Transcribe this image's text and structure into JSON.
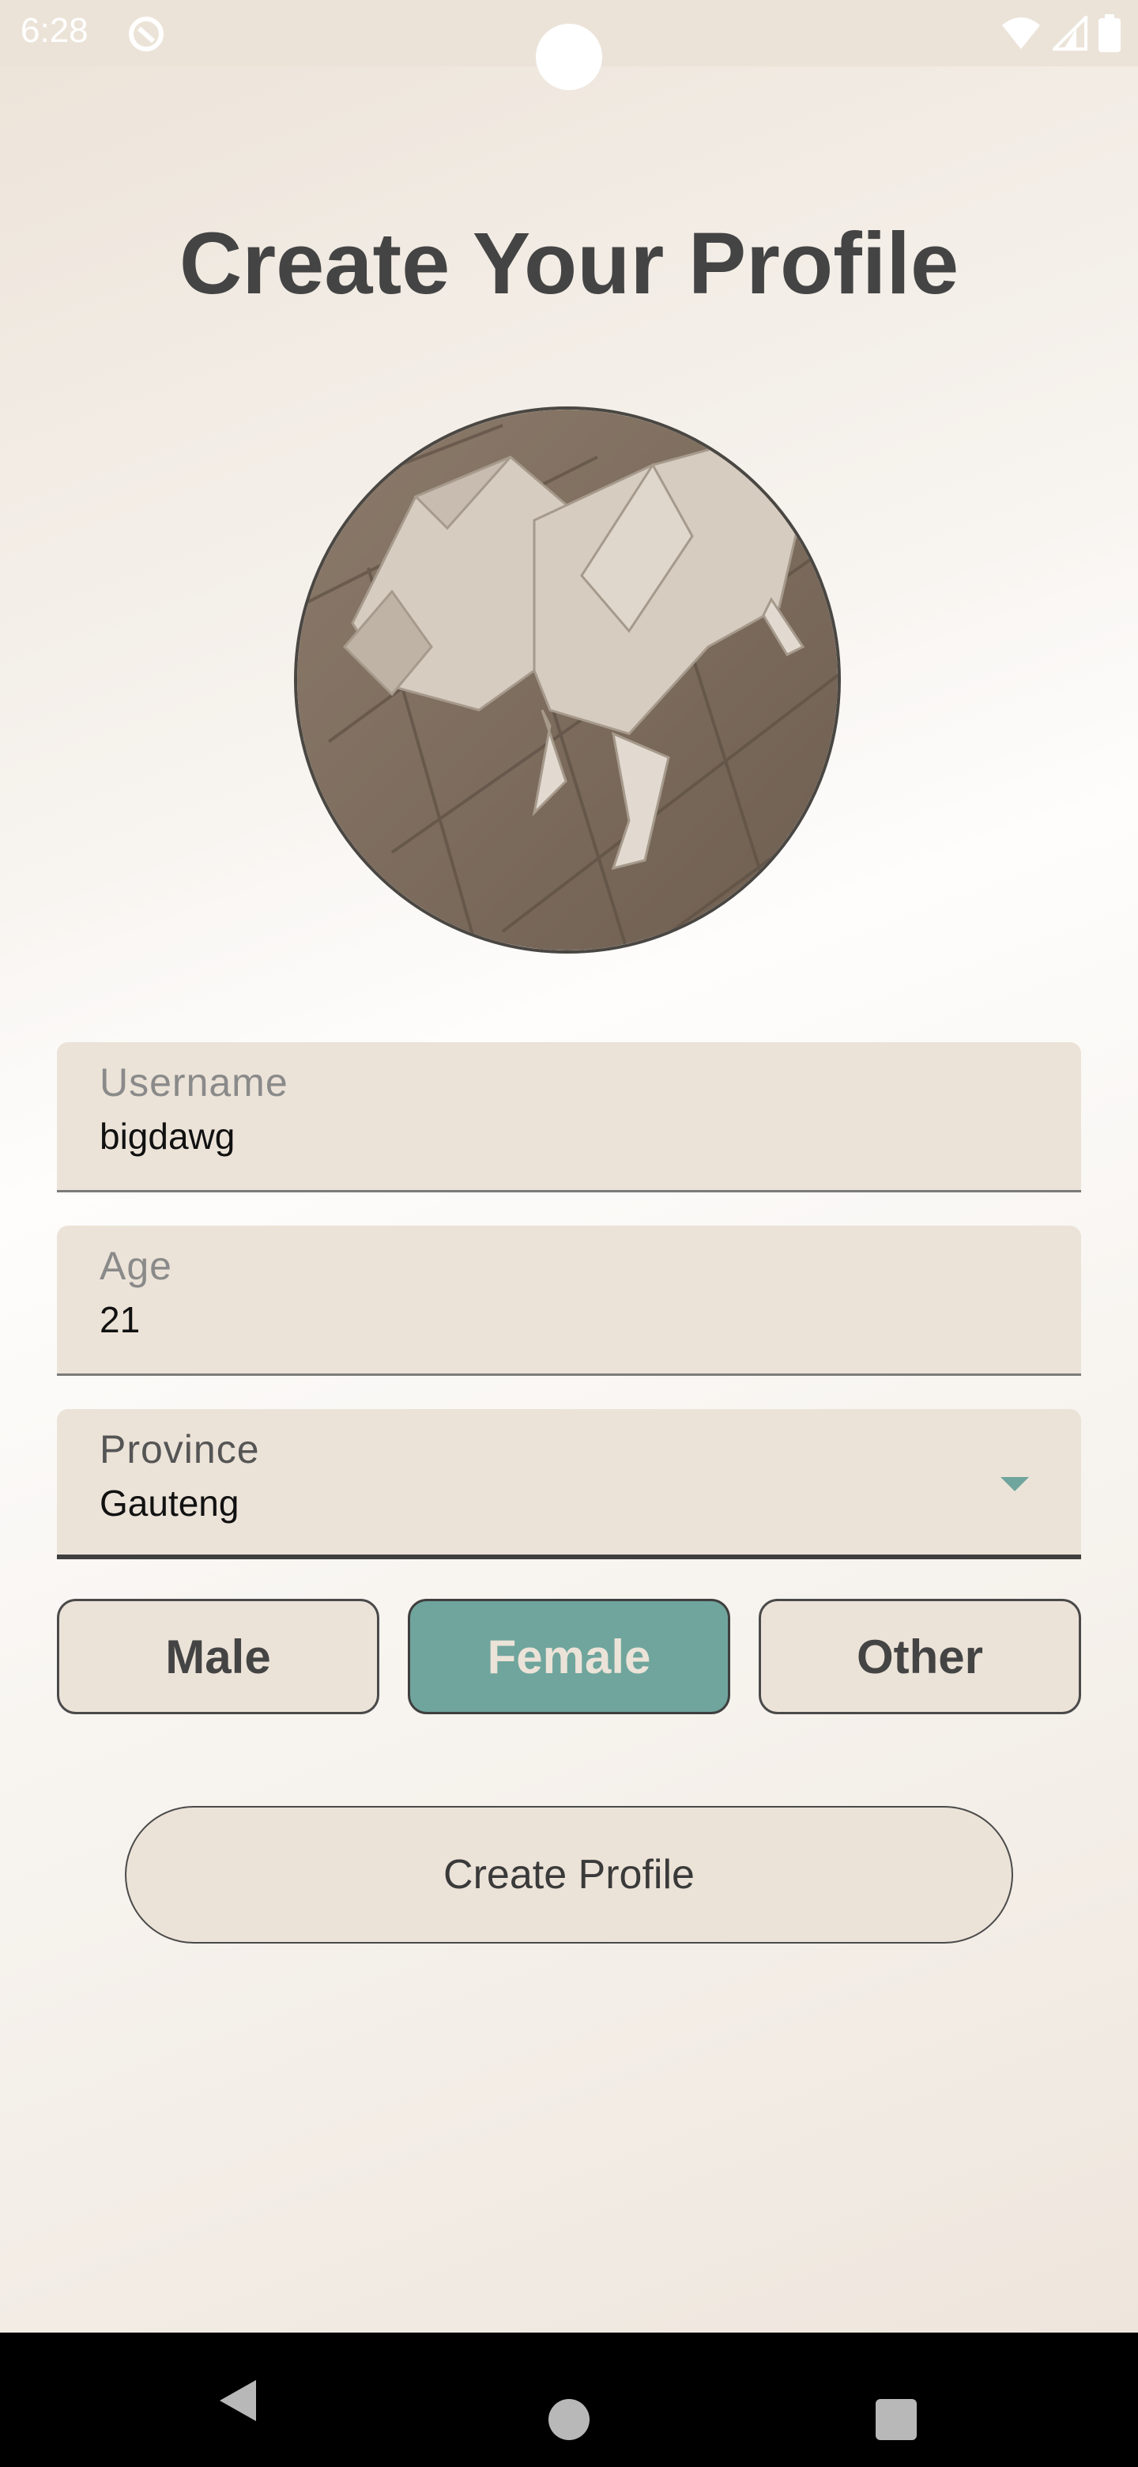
{
  "status_bar": {
    "time": "6:28",
    "icons": [
      "app-notification-icon",
      "wifi-icon",
      "signal-icon",
      "battery-icon"
    ]
  },
  "page": {
    "title": "Create Your Profile"
  },
  "avatar": {
    "icon": "profile-photo"
  },
  "form": {
    "username": {
      "label": "Username",
      "value": "bigdawg"
    },
    "age": {
      "label": "Age",
      "value": "21"
    },
    "province": {
      "label": "Province",
      "value": "Gauteng"
    }
  },
  "gender": {
    "options": [
      "Male",
      "Female",
      "Other"
    ],
    "selected": "Female"
  },
  "actions": {
    "create_label": "Create Profile"
  },
  "colors": {
    "background": "#ece3d8",
    "accent": "#6fa59c",
    "text": "#444444"
  },
  "nav_bar": {
    "icons": [
      "back-icon",
      "home-icon",
      "recents-icon"
    ]
  }
}
